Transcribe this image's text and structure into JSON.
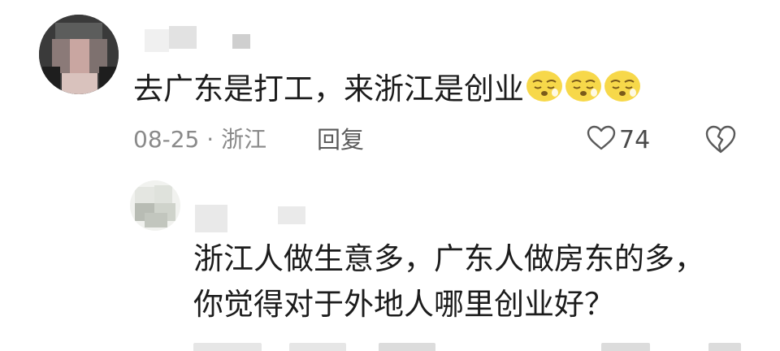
{
  "comments": [
    {
      "text": "去广东是打工，来浙江是创业",
      "emojis": [
        "sleepy-face-emoji",
        "sleepy-face-emoji",
        "sleepy-face-emoji"
      ],
      "date": "08-25",
      "separator": "·",
      "location": "浙江",
      "reply_label": "回复",
      "like_count": "74"
    }
  ],
  "reply": {
    "line1": "浙江人做生意多，广东人做房东的多，",
    "line2": "你觉得对于外地人哪里创业好？"
  },
  "colors": {
    "text": "#1c1c1c",
    "meta": "#8a8a8a",
    "emoji_face": "#f7d84a"
  }
}
